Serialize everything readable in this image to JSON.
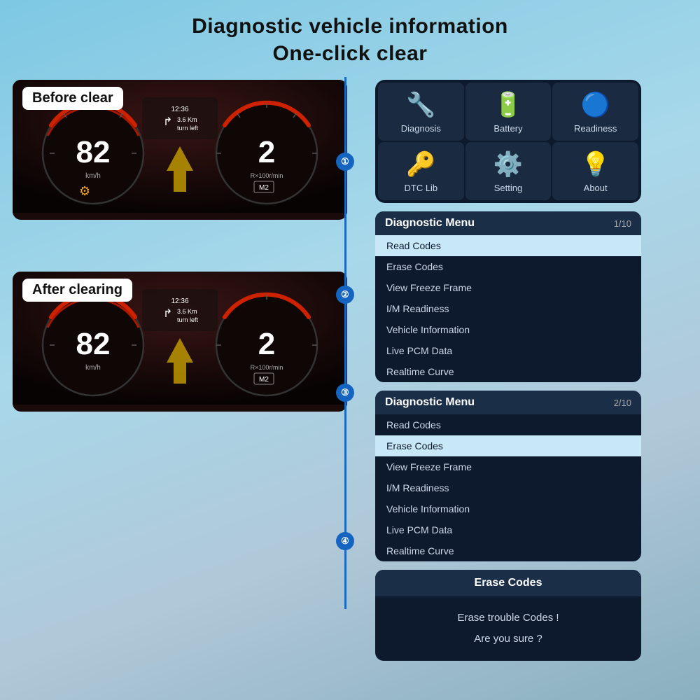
{
  "title": {
    "line1": "Diagnostic vehicle information",
    "line2": "One-click clear"
  },
  "labels": {
    "before_clear": "Before clear",
    "after_clearing": "After clearing"
  },
  "steps": [
    "①",
    "②",
    "③",
    "④"
  ],
  "icon_grid": {
    "items": [
      {
        "icon": "🔧",
        "label": "Diagnosis"
      },
      {
        "icon": "🔋",
        "label": "Battery"
      },
      {
        "icon": "🔵",
        "label": "Readiness"
      },
      {
        "icon": "🔑",
        "label": "DTC Lib"
      },
      {
        "icon": "⚙️",
        "label": "Setting"
      },
      {
        "icon": "💡",
        "label": "About"
      }
    ]
  },
  "menu1": {
    "title": "Diagnostic Menu",
    "page": "1/10",
    "items": [
      {
        "label": "Read Codes",
        "active": true
      },
      {
        "label": "Erase Codes",
        "active": false
      },
      {
        "label": "View Freeze Frame",
        "active": false
      },
      {
        "label": "I/M Readiness",
        "active": false
      },
      {
        "label": "Vehicle Information",
        "active": false
      },
      {
        "label": "Live PCM Data",
        "active": false
      },
      {
        "label": "Realtime Curve",
        "active": false
      }
    ]
  },
  "menu2": {
    "title": "Diagnostic Menu",
    "page": "2/10",
    "items": [
      {
        "label": "Read Codes",
        "active": false
      },
      {
        "label": "Erase Codes",
        "active": true
      },
      {
        "label": "View Freeze Frame",
        "active": false
      },
      {
        "label": "I/M Readiness",
        "active": false
      },
      {
        "label": "Vehicle Information",
        "active": false
      },
      {
        "label": "Live PCM Data",
        "active": false
      },
      {
        "label": "Realtime Curve",
        "active": false
      }
    ]
  },
  "erase_panel": {
    "title": "Erase Codes",
    "line1": "Erase trouble Codes !",
    "line2": "Are you sure ?"
  },
  "dashboard": {
    "speed": "82",
    "rpm": "2",
    "time": "12:36",
    "nav": "3.6 Km\nturn left",
    "gear": "M2"
  }
}
